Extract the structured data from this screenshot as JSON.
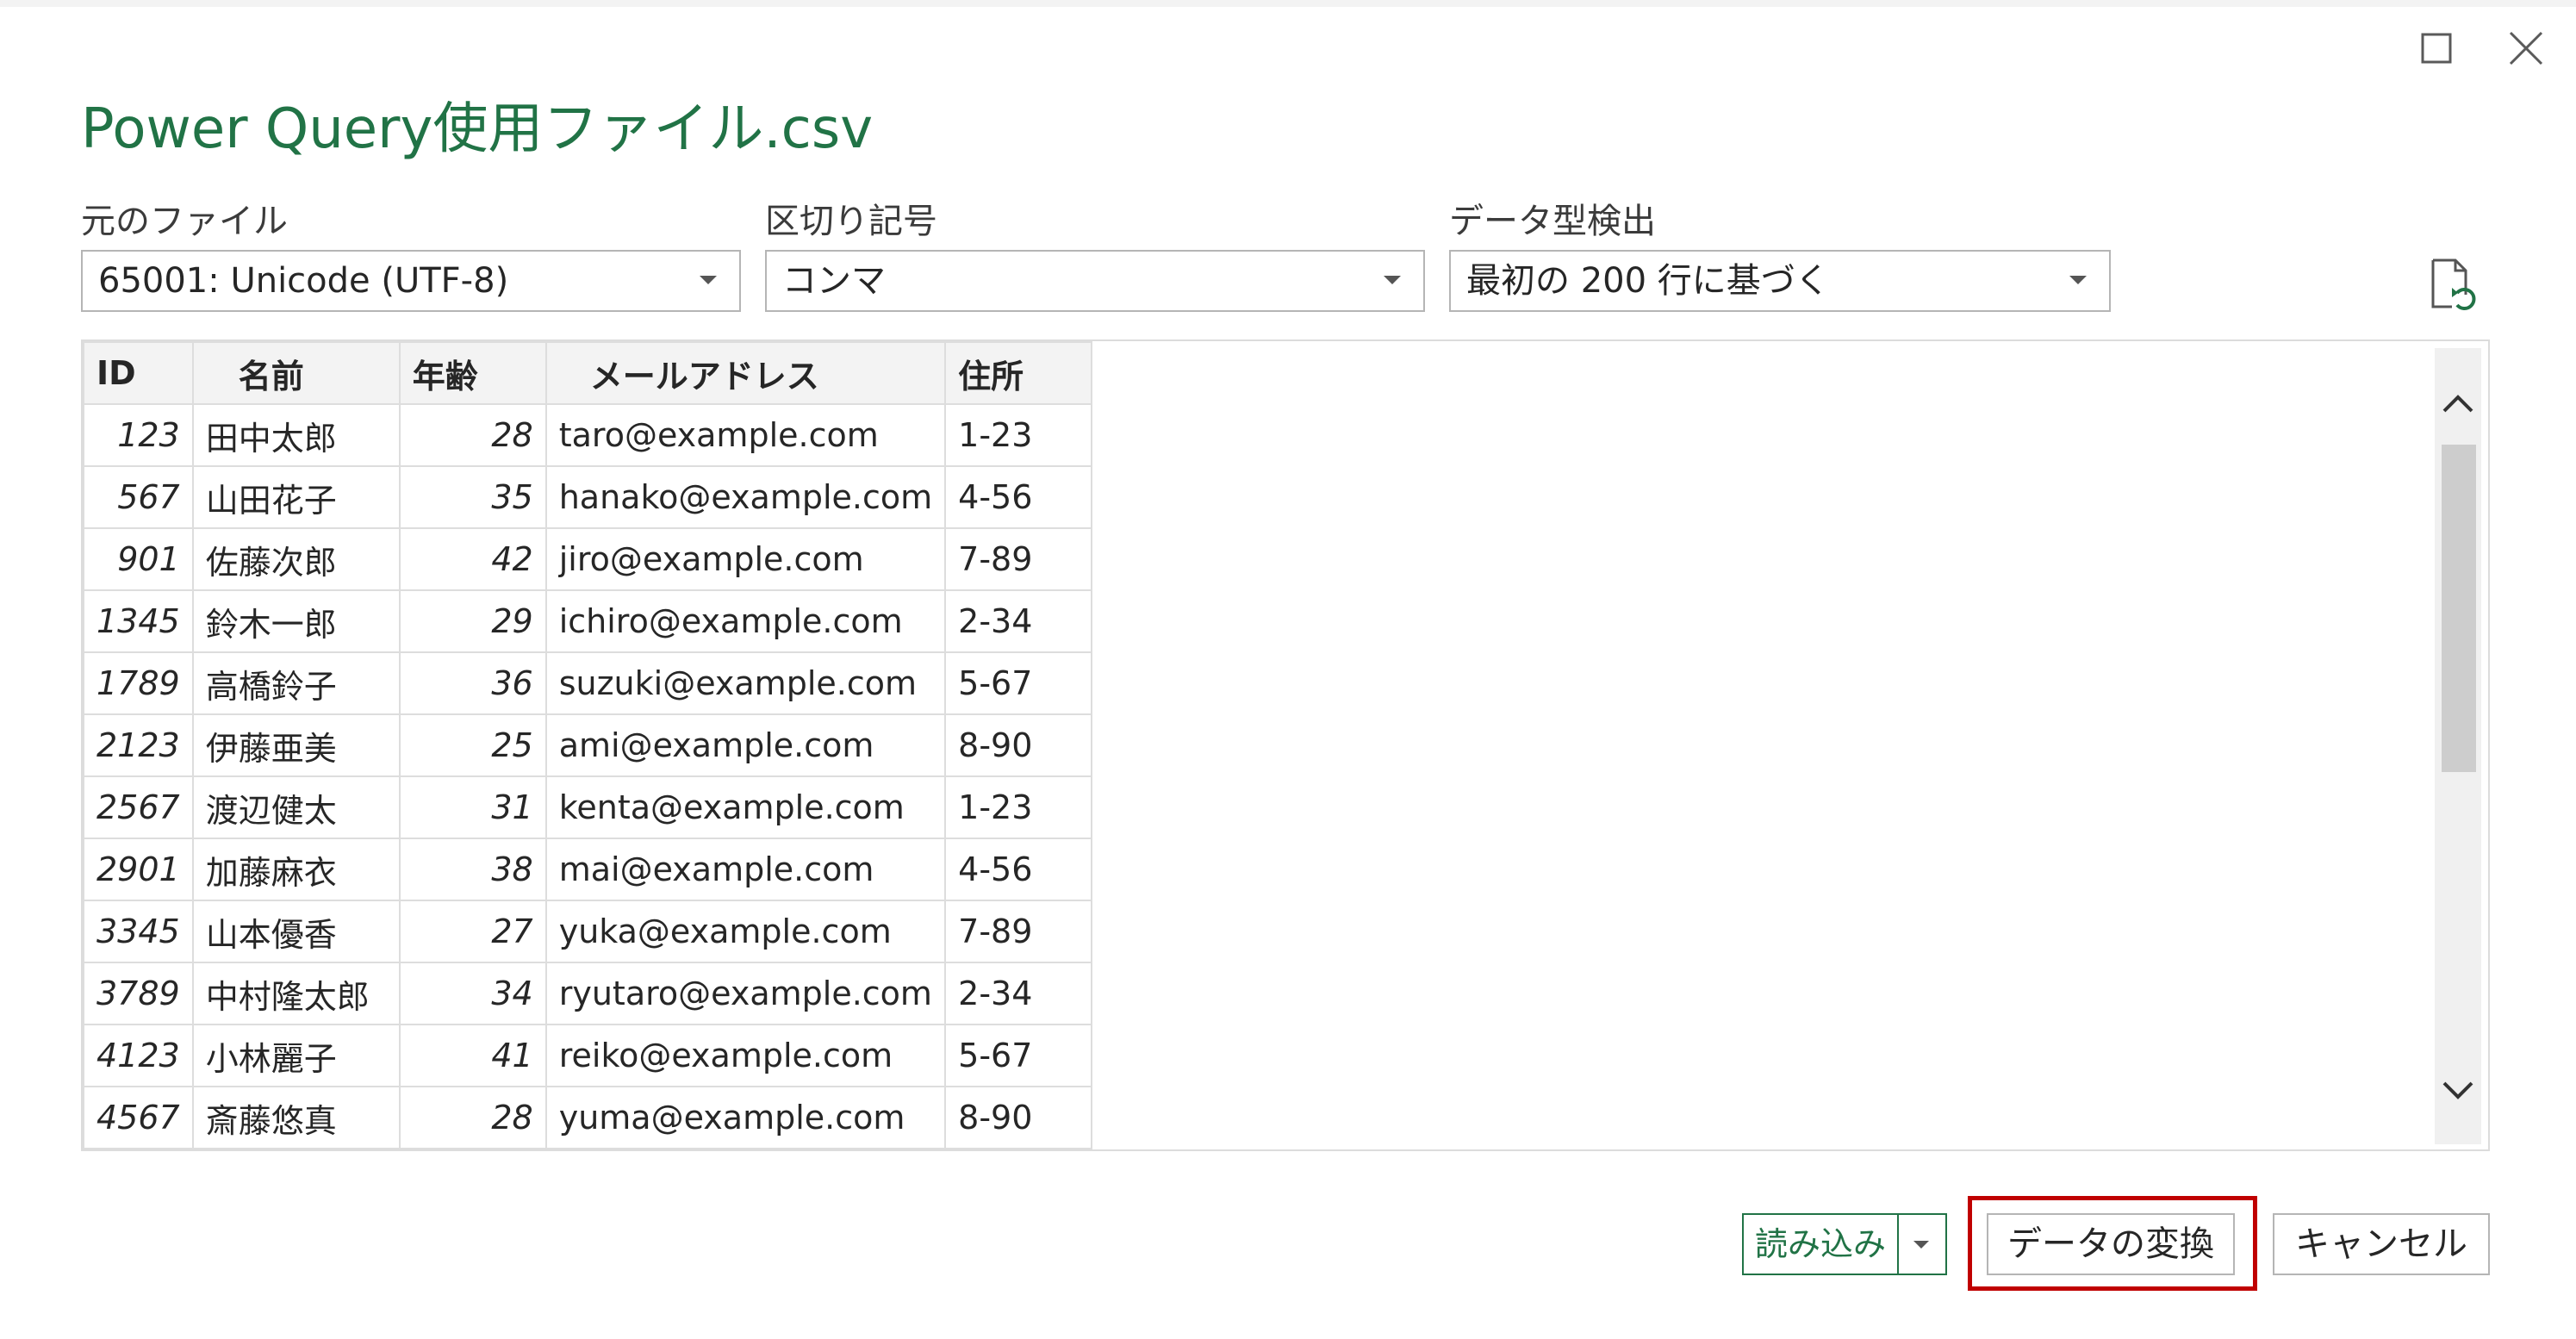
{
  "dialog": {
    "title": "Power Query使用ファイル.csv",
    "window_controls": [
      "maximize-icon",
      "close-icon"
    ]
  },
  "options": {
    "file_origin": {
      "label": "元のファイル",
      "value": "65001: Unicode (UTF-8)"
    },
    "delimiter": {
      "label": "区切り記号",
      "value": "コンマ"
    },
    "type_detection": {
      "label": "データ型検出",
      "value": "最初の 200 行に基づく"
    },
    "refresh_icon": "refresh-file-icon"
  },
  "table": {
    "columns": [
      "ID",
      "名前",
      "年齢",
      "メールアドレス",
      "住所"
    ],
    "rows": [
      [
        "123",
        "田中太郎",
        "28",
        "taro@example.com",
        "1-23"
      ],
      [
        "567",
        "山田花子",
        "35",
        "hanako@example.com",
        "4-56"
      ],
      [
        "901",
        "佐藤次郎",
        "42",
        "jiro@example.com",
        "7-89"
      ],
      [
        "1345",
        "鈴木一郎",
        "29",
        "ichiro@example.com",
        "2-34"
      ],
      [
        "1789",
        "高橋鈴子",
        "36",
        "suzuki@example.com",
        "5-67"
      ],
      [
        "2123",
        "伊藤亜美",
        "25",
        "ami@example.com",
        "8-90"
      ],
      [
        "2567",
        "渡辺健太",
        "31",
        "kenta@example.com",
        "1-23"
      ],
      [
        "2901",
        "加藤麻衣",
        "38",
        "mai@example.com",
        "4-56"
      ],
      [
        "3345",
        "山本優香",
        "27",
        "yuka@example.com",
        "7-89"
      ],
      [
        "3789",
        "中村隆太郎",
        "34",
        "ryutaro@example.com",
        "2-34"
      ],
      [
        "4123",
        "小林麗子",
        "41",
        "reiko@example.com",
        "5-67"
      ],
      [
        "4567",
        "斎藤悠真",
        "28",
        "yuma@example.com",
        "8-90"
      ]
    ]
  },
  "footer": {
    "load_label": "読み込み",
    "transform_label": "データの変換",
    "cancel_label": "キャンセル"
  },
  "colors": {
    "accent_green": "#217346",
    "highlight_red": "#c00000"
  }
}
